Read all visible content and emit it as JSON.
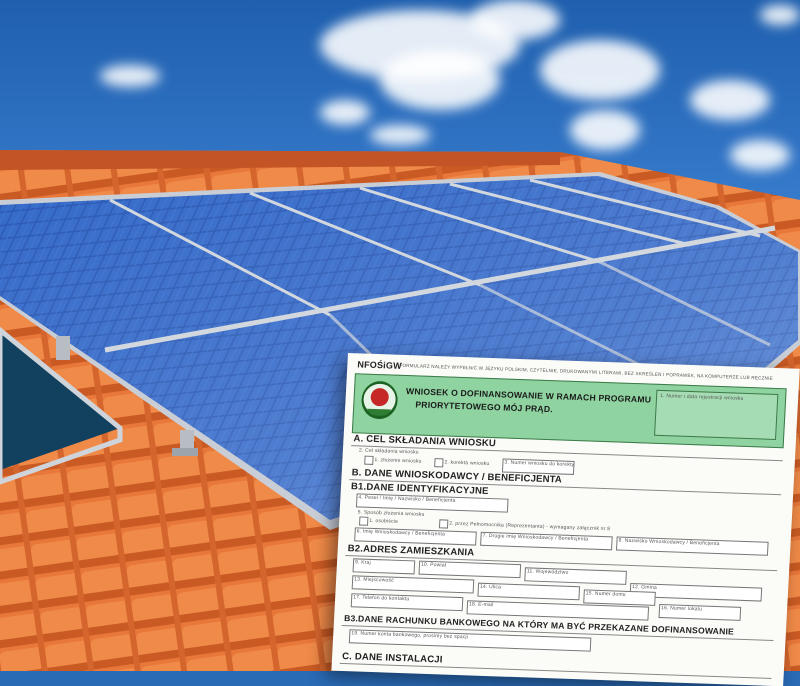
{
  "form": {
    "agency": "NFOŚiGW",
    "notice": "FORMULARZ NALEŻY WYPEŁNIĆ W JĘZYKU POLSKIM, CZYTELNIE, DRUKOWANYMI LITERAMI, BEZ SKREŚLEŃ I POPRAWEK, NA KOMPUTERZE LUB RĘCZNIE",
    "title_line1": "WNIOSEK O DOFINANSOWANIE W RAMACH PROGRAMU",
    "title_line2": "PRIORYTETOWEGO MÓJ PRĄD.",
    "number_box_label": "1. Numer i data rejestracji wniosku",
    "sections": {
      "a": "A.  CEL SKŁADANIA WNIOSKU",
      "b": "B.  DANE WNIOSKODAWCY / BENEFICJENTA",
      "b1": "B1.DANE IDENTYFIKACYJNE",
      "b2": "B2.ADRES ZAMIESZKANIA",
      "b3": "B3.DANE RACHUNKU BANKOWEGO NA KTÓRY MA BYĆ PRZEKAZANE DOFINANSOWANIE",
      "c": "C.  DANE INSTALACJI"
    },
    "fields": {
      "a_goal": "2. Cel składania wniosku",
      "a_opt1": "1. złożenie wniosku",
      "a_opt2": "2. korekta wniosku",
      "a_correction": "3. Numer wniosku do korekty",
      "b1_name": "4. Pesel / Imię / Nazwisko / Beneficjenta",
      "b1_status": "5. Sposób złożenia wniosku",
      "b1_opt1": "1. osobiście",
      "b1_opt2": "2. przez Pełnomocnika (Reprezentanta) - wymagany załącznik nr 8",
      "b1_first": "6. Imię Wnioskodawcy / Beneficjenta",
      "b1_second": "7. Drugie imię Wnioskodawcy / Beneficjenta",
      "b1_last": "8. Nazwisko Wnioskodawcy / Beneficjenta",
      "b2_country": "9. Kraj",
      "b2_county": "10. Powiat",
      "b2_province": "11. Województwo",
      "b2_municipality": "12. Gmina",
      "b2_city": "13. Miejscowość",
      "b2_street": "14. Ulica",
      "b2_house": "15. Numer domu",
      "b2_flat": "16. Numer lokalu",
      "b2_phone": "17. Telefon do kontaktu",
      "b2_email": "18. E-mail",
      "b3_account": "19. Numer konta bankowego, prosimy bez spacji"
    }
  }
}
